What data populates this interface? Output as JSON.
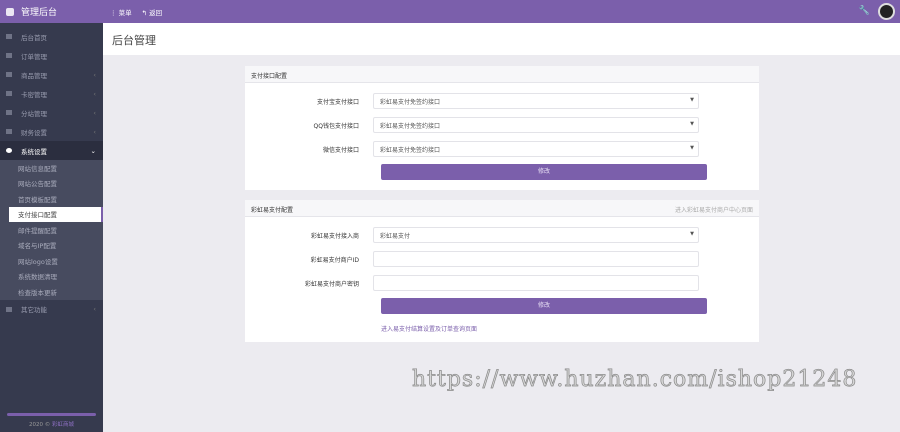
{
  "app": {
    "title": "管理后台"
  },
  "topnav": {
    "menu": "菜单",
    "back": "返回"
  },
  "page_title": "后台管理",
  "sidebar": {
    "items": [
      "后台首页",
      "订单管理",
      "商品管理",
      "卡密管理",
      "分站管理",
      "财务设置",
      "系统设置",
      "其它功能"
    ],
    "sub": [
      "网站信息配置",
      "网站公告配置",
      "首页模板配置",
      "支付接口配置",
      "邮件提醒配置",
      "域名与IP配置",
      "网站logo设置",
      "系统数据清理",
      "检查版本更新"
    ],
    "footer_year": "2020 ©",
    "footer_name": "彩虹商城"
  },
  "panel1": {
    "title": "支付接口配置",
    "rows": [
      {
        "label": "支付宝支付接口",
        "value": "彩虹易支付免签约接口"
      },
      {
        "label": "QQ钱包支付接口",
        "value": "彩虹易支付免签约接口"
      },
      {
        "label": "微信支付接口",
        "value": "彩虹易支付免签约接口"
      }
    ],
    "submit": "修改"
  },
  "panel2": {
    "title": "彩虹易支付配置",
    "header_link": "进入彩虹易支付商户中心页面",
    "provider_label": "彩虹易支付接入商",
    "provider_value": "彩虹易支付",
    "pid_label": "彩虹易支付商户ID",
    "pid_value": "",
    "key_label": "彩虹易支付商户密钥",
    "key_value": "",
    "submit": "修改",
    "footer_link": "进入易支付结算设置及订单查询页面"
  },
  "watermark": "https://www.huzhan.com/ishop21248"
}
